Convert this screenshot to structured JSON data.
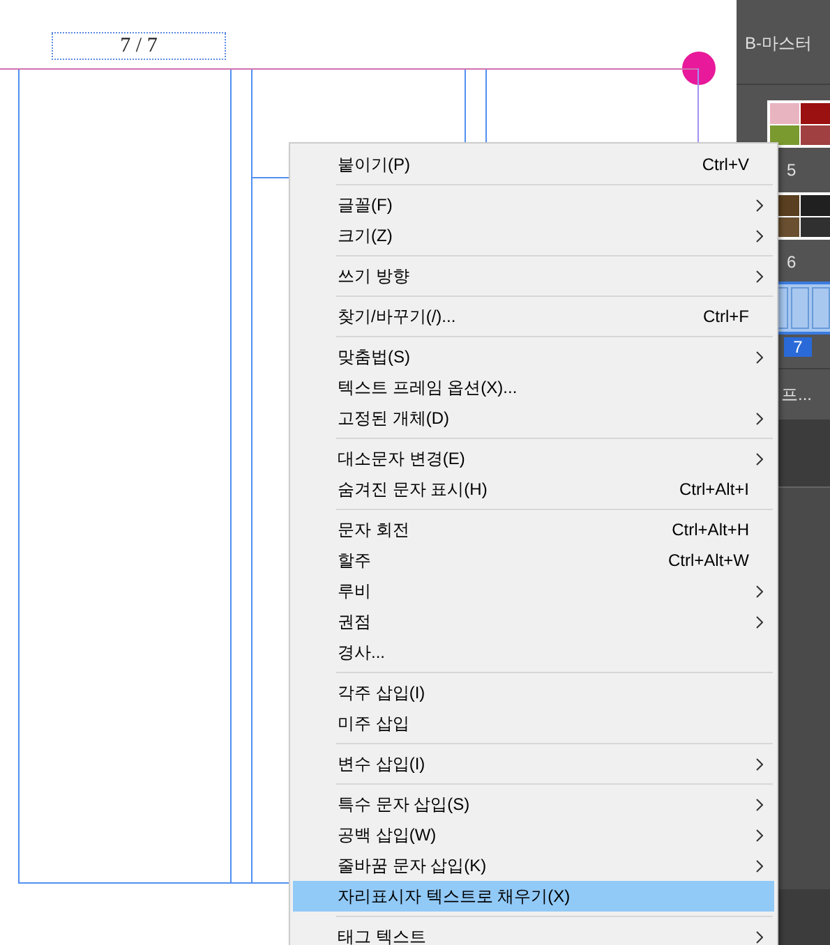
{
  "page_number": "7 / 7",
  "side_panel": {
    "masters": [
      "B-마스터"
    ],
    "pages": [
      {
        "label": "5",
        "kind": "photos",
        "selected": false
      },
      {
        "label": "6",
        "kind": "dark-photos",
        "selected": false
      },
      {
        "label": "7",
        "kind": "columns",
        "selected": true
      }
    ],
    "footer": "프..."
  },
  "context_menu": [
    {
      "kind": "item",
      "label": "붙이기(P)",
      "shortcut": "Ctrl+V",
      "submenu": false,
      "selected": false
    },
    {
      "kind": "separator"
    },
    {
      "kind": "item",
      "label": "글꼴(F)",
      "submenu": true,
      "selected": false
    },
    {
      "kind": "item",
      "label": "크기(Z)",
      "submenu": true,
      "selected": false
    },
    {
      "kind": "separator"
    },
    {
      "kind": "item",
      "label": "쓰기 방향",
      "submenu": true,
      "selected": false
    },
    {
      "kind": "separator"
    },
    {
      "kind": "item",
      "label": "찾기/바꾸기(/)...",
      "shortcut": "Ctrl+F",
      "submenu": false,
      "selected": false
    },
    {
      "kind": "separator"
    },
    {
      "kind": "item",
      "label": "맞춤법(S)",
      "submenu": true,
      "selected": false
    },
    {
      "kind": "item",
      "label": "텍스트 프레임 옵션(X)...",
      "submenu": false,
      "selected": false
    },
    {
      "kind": "item",
      "label": "고정된 개체(D)",
      "submenu": true,
      "selected": false
    },
    {
      "kind": "separator"
    },
    {
      "kind": "item",
      "label": "대소문자 변경(E)",
      "submenu": true,
      "selected": false
    },
    {
      "kind": "item",
      "label": "숨겨진 문자 표시(H)",
      "shortcut": "Ctrl+Alt+I",
      "submenu": false,
      "selected": false
    },
    {
      "kind": "separator"
    },
    {
      "kind": "item",
      "label": "문자 회전",
      "shortcut": "Ctrl+Alt+H",
      "submenu": false,
      "selected": false
    },
    {
      "kind": "item",
      "label": "할주",
      "shortcut": "Ctrl+Alt+W",
      "submenu": false,
      "selected": false
    },
    {
      "kind": "item",
      "label": "루비",
      "submenu": true,
      "selected": false
    },
    {
      "kind": "item",
      "label": "권점",
      "submenu": true,
      "selected": false
    },
    {
      "kind": "item",
      "label": "경사...",
      "submenu": false,
      "selected": false
    },
    {
      "kind": "separator"
    },
    {
      "kind": "item",
      "label": "각주 삽입(I)",
      "submenu": false,
      "selected": false
    },
    {
      "kind": "item",
      "label": "미주 삽입",
      "submenu": false,
      "selected": false
    },
    {
      "kind": "separator"
    },
    {
      "kind": "item",
      "label": "변수 삽입(I)",
      "submenu": true,
      "selected": false
    },
    {
      "kind": "separator"
    },
    {
      "kind": "item",
      "label": "특수 문자 삽입(S)",
      "submenu": true,
      "selected": false
    },
    {
      "kind": "item",
      "label": "공백 삽입(W)",
      "submenu": true,
      "selected": false
    },
    {
      "kind": "item",
      "label": "줄바꿈 문자 삽입(K)",
      "submenu": true,
      "selected": false
    },
    {
      "kind": "item",
      "label": "자리표시자 텍스트로 채우기(X)",
      "submenu": false,
      "selected": true
    },
    {
      "kind": "separator"
    },
    {
      "kind": "item",
      "label": "태그 텍스트",
      "submenu": true,
      "selected": false
    }
  ]
}
